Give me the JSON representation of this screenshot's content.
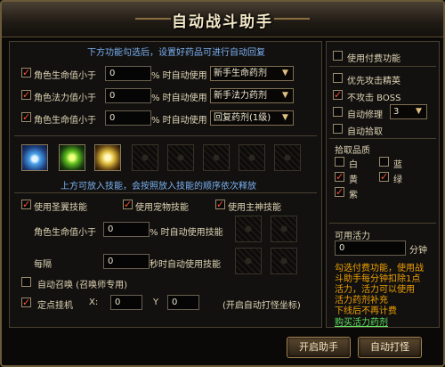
{
  "window": {
    "title": "自动战斗助手"
  },
  "recover": {
    "hint": "下方功能勾选后，设置好药品可进行自动回复",
    "rows": [
      {
        "label": "角色生命值小于",
        "value": "0",
        "suffix": "% 时自动使用",
        "item": "新手生命药剂",
        "checked": true
      },
      {
        "label": "角色法力值小于",
        "value": "0",
        "suffix": "% 时自动使用",
        "item": "新手法力药剂",
        "checked": true
      },
      {
        "label": "角色生命值小于",
        "value": "0",
        "suffix": "% 时自动使用",
        "item": "回复药剂(1级)",
        "checked": true
      }
    ]
  },
  "skills": {
    "hint": "上方可放入技能，会按照放入技能的顺序依次释放",
    "filled_slots": [
      "ice-skill-icon",
      "green-star-skill-icon",
      "gold-burst-skill-icon"
    ],
    "empty_slots": 5
  },
  "options": {
    "use_holy_beast": "使用圣翼技能",
    "use_pet": "使用宠物技能",
    "use_god": "使用主神技能",
    "hp_label": "角色生命值小于",
    "hp_value": "0",
    "hp_suffix": "% 时自动使用技能",
    "every_label": "每隔",
    "every_value": "0",
    "every_suffix": "秒时自动使用技能",
    "auto_summon": "自动召唤 (召唤师专用)",
    "fixed_hang": "定点挂机",
    "x_label": "X:",
    "x_value": "0",
    "y_label": "Y",
    "y_value": "0",
    "auto_coord": "(开启自动打怪坐标)"
  },
  "right": {
    "paid": "使用付费功能",
    "priority_elite": "优先攻击精英",
    "no_boss": "不攻击 BOSS",
    "auto_repair": "自动修理",
    "repair_value": "3",
    "auto_pickup": "自动拾取",
    "quality_title": "拾取品质",
    "quality": [
      {
        "label": "白",
        "checked": false
      },
      {
        "label": "蓝",
        "checked": false
      },
      {
        "label": "黄",
        "checked": true
      },
      {
        "label": "绿",
        "checked": true
      },
      {
        "label": "紫",
        "checked": true
      }
    ],
    "energy_title": "可用活力",
    "energy_value": "0",
    "energy_unit": "分钟",
    "notice_lines": [
      "勾选付费功能，使用战",
      "斗助手每分钟扣除1点",
      "活力，活力可以使用",
      "活力药剂补充",
      "下线后不再计费"
    ],
    "buy": "购买活力药剂"
  },
  "buttons": {
    "start": "开启助手",
    "auto_attack": "自动打怪"
  },
  "colors": {
    "hint": "#7ab0f0",
    "check": "#ff5030",
    "buy": "#60e060",
    "gold_text": "#f0a000"
  }
}
